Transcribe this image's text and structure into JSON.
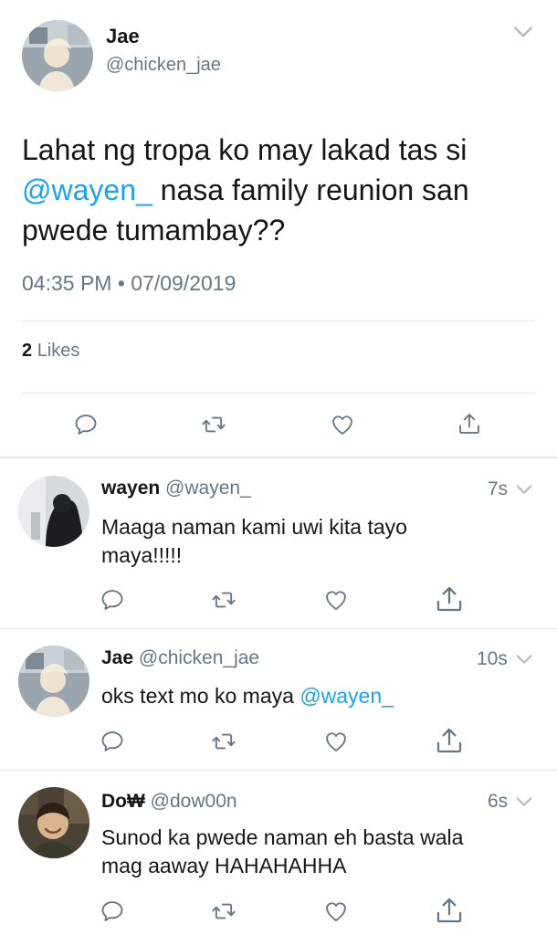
{
  "main_tweet": {
    "name": "Jae",
    "handle": "@chicken_jae",
    "text_part1": "Lahat ng tropa ko may lakad tas si",
    "mention": "@wayen_",
    "text_part2": " nasa family reunion san",
    "text_part3": "pwede tumambay??",
    "timestamp": "04:35 PM • 07/09/2019",
    "likes_count": "2",
    "likes_label": "Likes"
  },
  "replies": [
    {
      "name": "wayen",
      "handle": "@wayen_",
      "time": "7s",
      "line1": "Maaga naman kami uwi kita tayo",
      "line2": "maya!!!!!"
    },
    {
      "name": "Jae",
      "handle": "@chicken_jae",
      "time": "10s",
      "text": "oks text mo ko maya ",
      "mention": "@wayen_"
    },
    {
      "name": "Do₩",
      "handle": "@dow00n",
      "time": "6s",
      "line1": "Sunod ka pwede naman eh basta wala",
      "line2": "mag aaway HAHAHAHHA"
    }
  ],
  "icons": [
    "reply-icon",
    "retweet-icon",
    "like-icon",
    "share-icon",
    "chevron-down-icon"
  ],
  "colors": {
    "accent": "#1da1f2",
    "muted": "#657786",
    "divider": "#e1e8ed"
  }
}
